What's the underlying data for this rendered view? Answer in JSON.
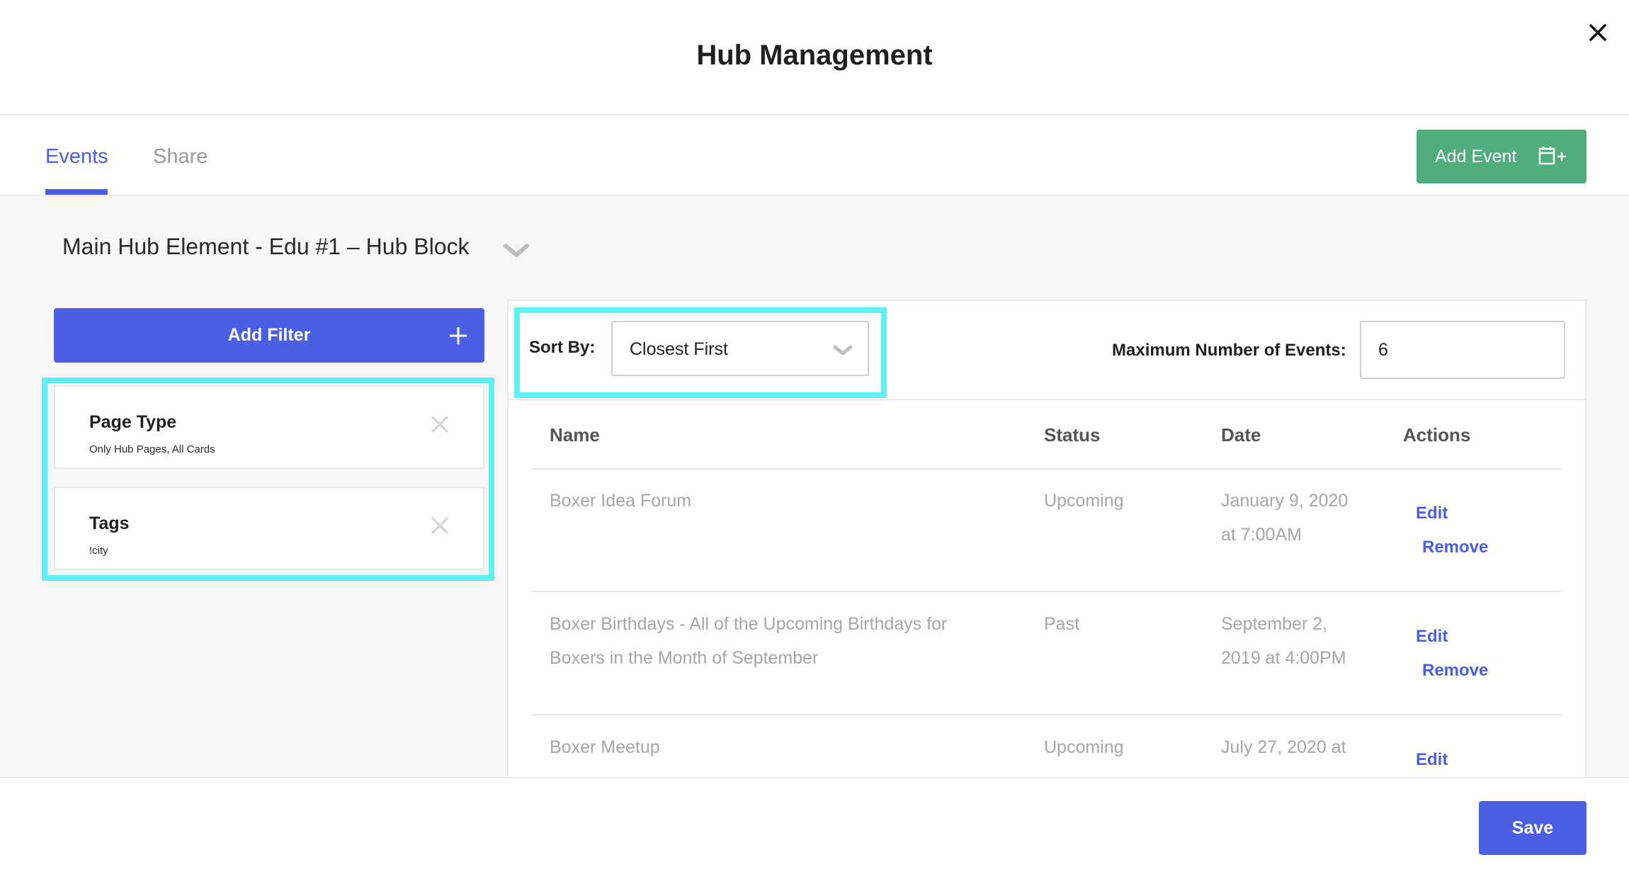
{
  "dialog": {
    "title": "Hub Management",
    "close_icon": "close-icon"
  },
  "tabs": [
    {
      "label": "Events",
      "active": true
    },
    {
      "label": "Share",
      "active": false
    }
  ],
  "add_event": {
    "label": "Add Event",
    "icon": "calendar-plus-icon"
  },
  "block": {
    "title": "Main Hub Element - Edu #1 – Hub Block"
  },
  "filters": {
    "add_label": "Add Filter",
    "items": [
      {
        "name": "Page Type",
        "value": "Only Hub Pages, All Cards"
      },
      {
        "name": "Tags",
        "value": "!city"
      }
    ]
  },
  "sort": {
    "label": "Sort By:",
    "selected": "Closest First"
  },
  "max_events": {
    "label": "Maximum Number of Events:",
    "value": "6"
  },
  "table": {
    "columns": [
      "Name",
      "Status",
      "Date",
      "Actions"
    ],
    "rows": [
      {
        "name_l1": "Boxer Idea Forum",
        "name_l2": "",
        "status": "Upcoming",
        "date_l1": "January 9, 2020",
        "date_l2": "at 7:00AM",
        "edit": "Edit",
        "remove": "Remove"
      },
      {
        "name_l1": "Boxer Birthdays - All of the Upcoming Birthdays for",
        "name_l2": "Boxers in the Month of September",
        "status": "Past",
        "date_l1": "September 2,",
        "date_l2": "2019 at 4:00PM",
        "edit": "Edit",
        "remove": "Remove"
      },
      {
        "name_l1": "Boxer Meetup",
        "name_l2": "",
        "status": "Upcoming",
        "date_l1": "July 27, 2020 at",
        "date_l2": "",
        "edit": "Edit",
        "remove": ""
      }
    ]
  },
  "footer": {
    "save_label": "Save"
  },
  "colors": {
    "primary": "#4a5fe3",
    "success": "#4fae7c",
    "highlight": "#5ef0f2"
  }
}
